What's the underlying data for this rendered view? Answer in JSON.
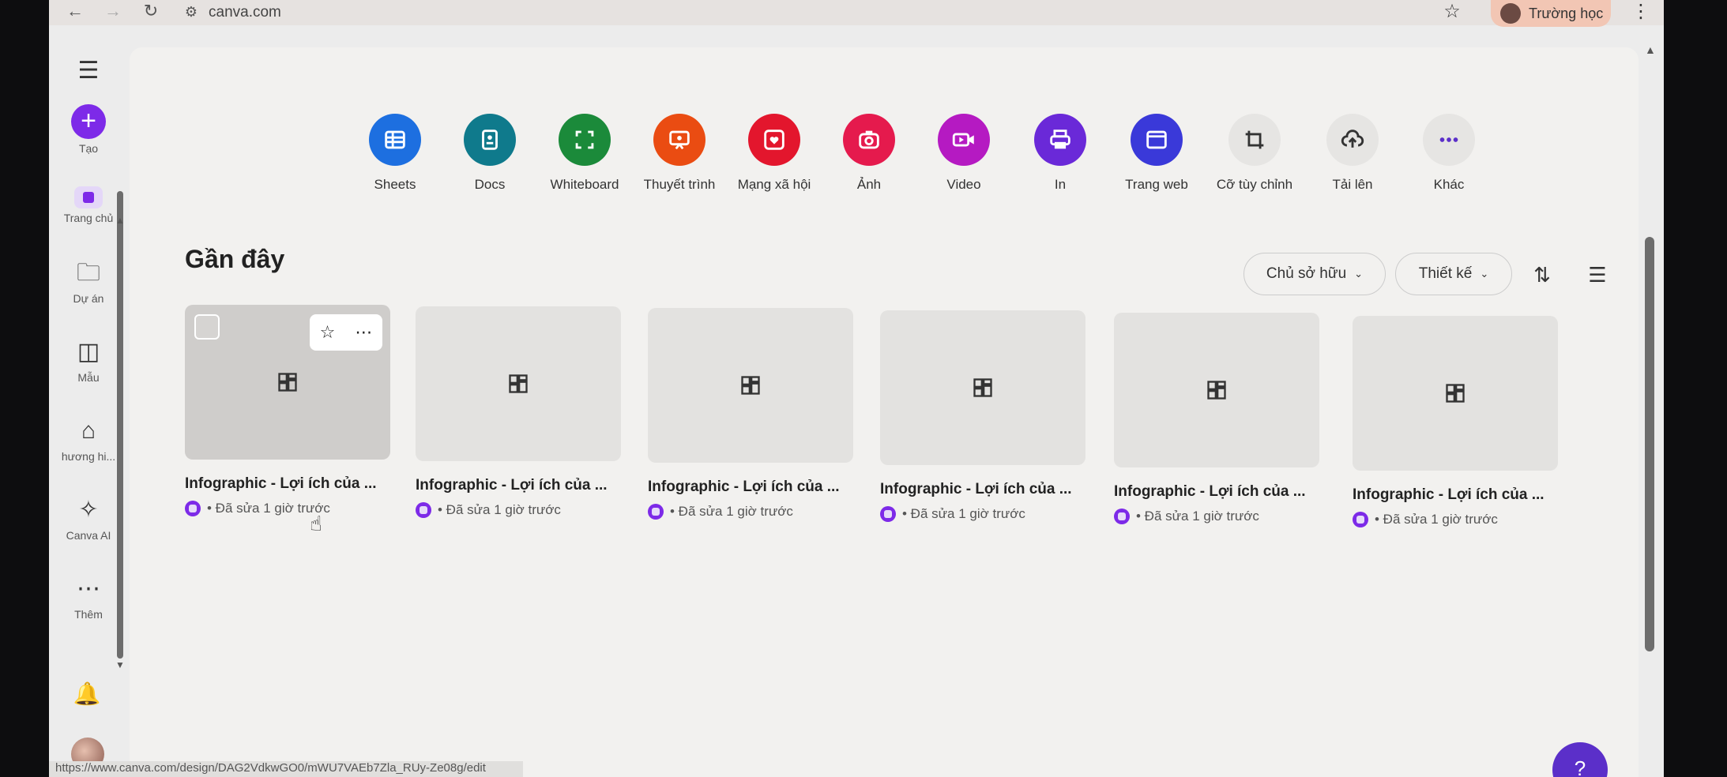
{
  "browser": {
    "url": "canva.com",
    "profile_name": "Trường học",
    "status_url": "https://www.canva.com/design/DAG2VdkwGO0/mWU7VAEb7Zla_RUy-Ze08g/edit"
  },
  "sidebar": {
    "items": [
      {
        "label": "Tạo",
        "icon": "plus-icon"
      },
      {
        "label": "Trang chủ",
        "icon": "home-icon"
      },
      {
        "label": "Dự án",
        "icon": "folder-icon"
      },
      {
        "label": "Mẫu",
        "icon": "templates-icon"
      },
      {
        "label": "hương hi...",
        "icon": "brand-icon"
      },
      {
        "label": "Canva AI",
        "icon": "sparkle-icon"
      },
      {
        "label": "Thêm",
        "icon": "more-icon"
      }
    ]
  },
  "design_types": [
    {
      "label": "Sheets",
      "color": "#1d6fe0",
      "icon": "sheets-icon"
    },
    {
      "label": "Docs",
      "color": "#0f7a8c",
      "icon": "docs-icon"
    },
    {
      "label": "Whiteboard",
      "color": "#1b8a3a",
      "icon": "whiteboard-icon"
    },
    {
      "label": "Thuyết trình",
      "color": "#ea4c12",
      "icon": "presentation-icon"
    },
    {
      "label": "Mạng xã hội",
      "color": "#e3162d",
      "icon": "social-icon"
    },
    {
      "label": "Ảnh",
      "color": "#e51a4d",
      "icon": "camera-icon"
    },
    {
      "label": "Video",
      "color": "#b51ac2",
      "icon": "video-icon"
    },
    {
      "label": "In",
      "color": "#6a29d8",
      "icon": "print-icon"
    },
    {
      "label": "Trang web",
      "color": "#3a39d9",
      "icon": "website-icon"
    },
    {
      "label": "Cỡ tùy chỉnh",
      "color": "#e6e5e3",
      "icon": "custom-size-icon"
    },
    {
      "label": "Tải lên",
      "color": "#e6e5e3",
      "icon": "upload-icon"
    },
    {
      "label": "Khác",
      "color": "#e6e5e3",
      "icon": "more-icon"
    }
  ],
  "recent": {
    "title": "Gần đây",
    "filters": {
      "owner": "Chủ sở hữu",
      "type": "Thiết kế"
    },
    "cards": [
      {
        "title": "Infographic - Lợi ích của ...",
        "meta": "• Đã sửa 1 giờ trước"
      },
      {
        "title": "Infographic - Lợi ích của ...",
        "meta": "• Đã sửa 1 giờ trước"
      },
      {
        "title": "Infographic - Lợi ích của ...",
        "meta": "• Đã sửa 1 giờ trước"
      },
      {
        "title": "Infographic - Lợi ích của ...",
        "meta": "• Đã sửa 1 giờ trước"
      },
      {
        "title": "Infographic - Lợi ích của ...",
        "meta": "• Đã sửa 1 giờ trước"
      },
      {
        "title": "Infographic - Lợi ích của ...",
        "meta": "• Đã sửa 1 giờ trước"
      }
    ]
  },
  "help_label": "?"
}
